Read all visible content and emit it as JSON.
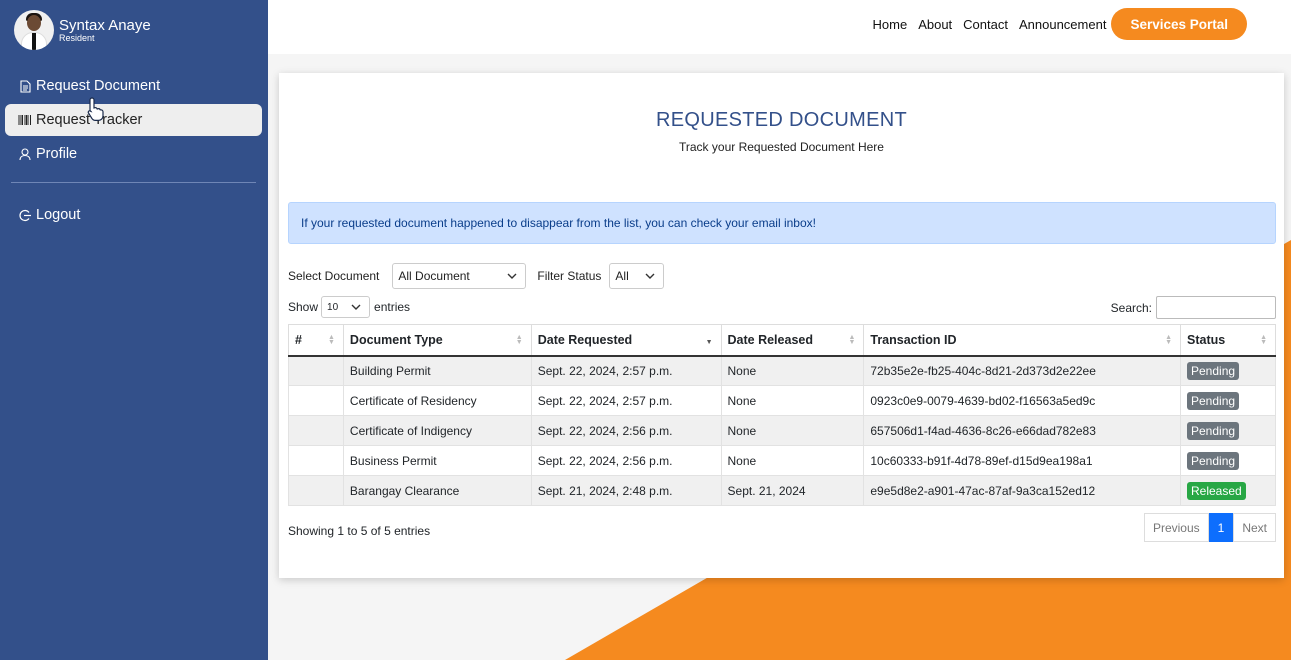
{
  "user": {
    "name": "Syntax Anaye",
    "role": "Resident"
  },
  "sidebar": {
    "items": [
      {
        "label": "Request Document"
      },
      {
        "label": "Request Tracker"
      },
      {
        "label": "Profile"
      }
    ],
    "logout": "Logout"
  },
  "topnav": {
    "links": [
      "Home",
      "About",
      "Contact",
      "Announcement"
    ],
    "services_label": "Services Portal"
  },
  "page": {
    "title": "REQUESTED DOCUMENT",
    "subtitle": "Track your Requested Document Here",
    "alert": "If your requested document happened to disappear from the list, you can check your email inbox!"
  },
  "filters": {
    "select_document_label": "Select Document",
    "select_document_value": "All Document",
    "filter_status_label": "Filter Status",
    "filter_status_value": "All"
  },
  "table_controls": {
    "show_label": "Show",
    "show_value": "10",
    "entries_label": "entries",
    "search_label": "Search:"
  },
  "table": {
    "columns": [
      "#",
      "Document Type",
      "Date Requested",
      "Date Released",
      "Transaction ID",
      "Status"
    ],
    "rows": [
      {
        "num": "",
        "type": "Building Permit",
        "requested": "Sept. 22, 2024, 2:57 p.m.",
        "released": "None",
        "txn": "72b35e2e-fb25-404c-8d21-2d373d2e22ee",
        "status": "Pending"
      },
      {
        "num": "",
        "type": "Certificate of Residency",
        "requested": "Sept. 22, 2024, 2:57 p.m.",
        "released": "None",
        "txn": "0923c0e9-0079-4639-bd02-f16563a5ed9c",
        "status": "Pending"
      },
      {
        "num": "",
        "type": "Certificate of Indigency",
        "requested": "Sept. 22, 2024, 2:56 p.m.",
        "released": "None",
        "txn": "657506d1-f4ad-4636-8c26-e66dad782e83",
        "status": "Pending"
      },
      {
        "num": "",
        "type": "Business Permit",
        "requested": "Sept. 22, 2024, 2:56 p.m.",
        "released": "None",
        "txn": "10c60333-b91f-4d78-89ef-d15d9ea198a1",
        "status": "Pending"
      },
      {
        "num": "",
        "type": "Barangay Clearance",
        "requested": "Sept. 21, 2024, 2:48 p.m.",
        "released": "Sept. 21, 2024",
        "txn": "e9e5d8e2-a901-47ac-87af-9a3ca152ed12",
        "status": "Released"
      }
    ]
  },
  "pagination": {
    "info": "Showing 1 to 5 of 5 entries",
    "previous": "Previous",
    "current": "1",
    "next": "Next"
  },
  "colors": {
    "sidebar": "#33508a",
    "accent": "#f58a1f",
    "pending": "#6c757d",
    "released": "#28a745",
    "alert_bg": "#cfe2ff"
  }
}
